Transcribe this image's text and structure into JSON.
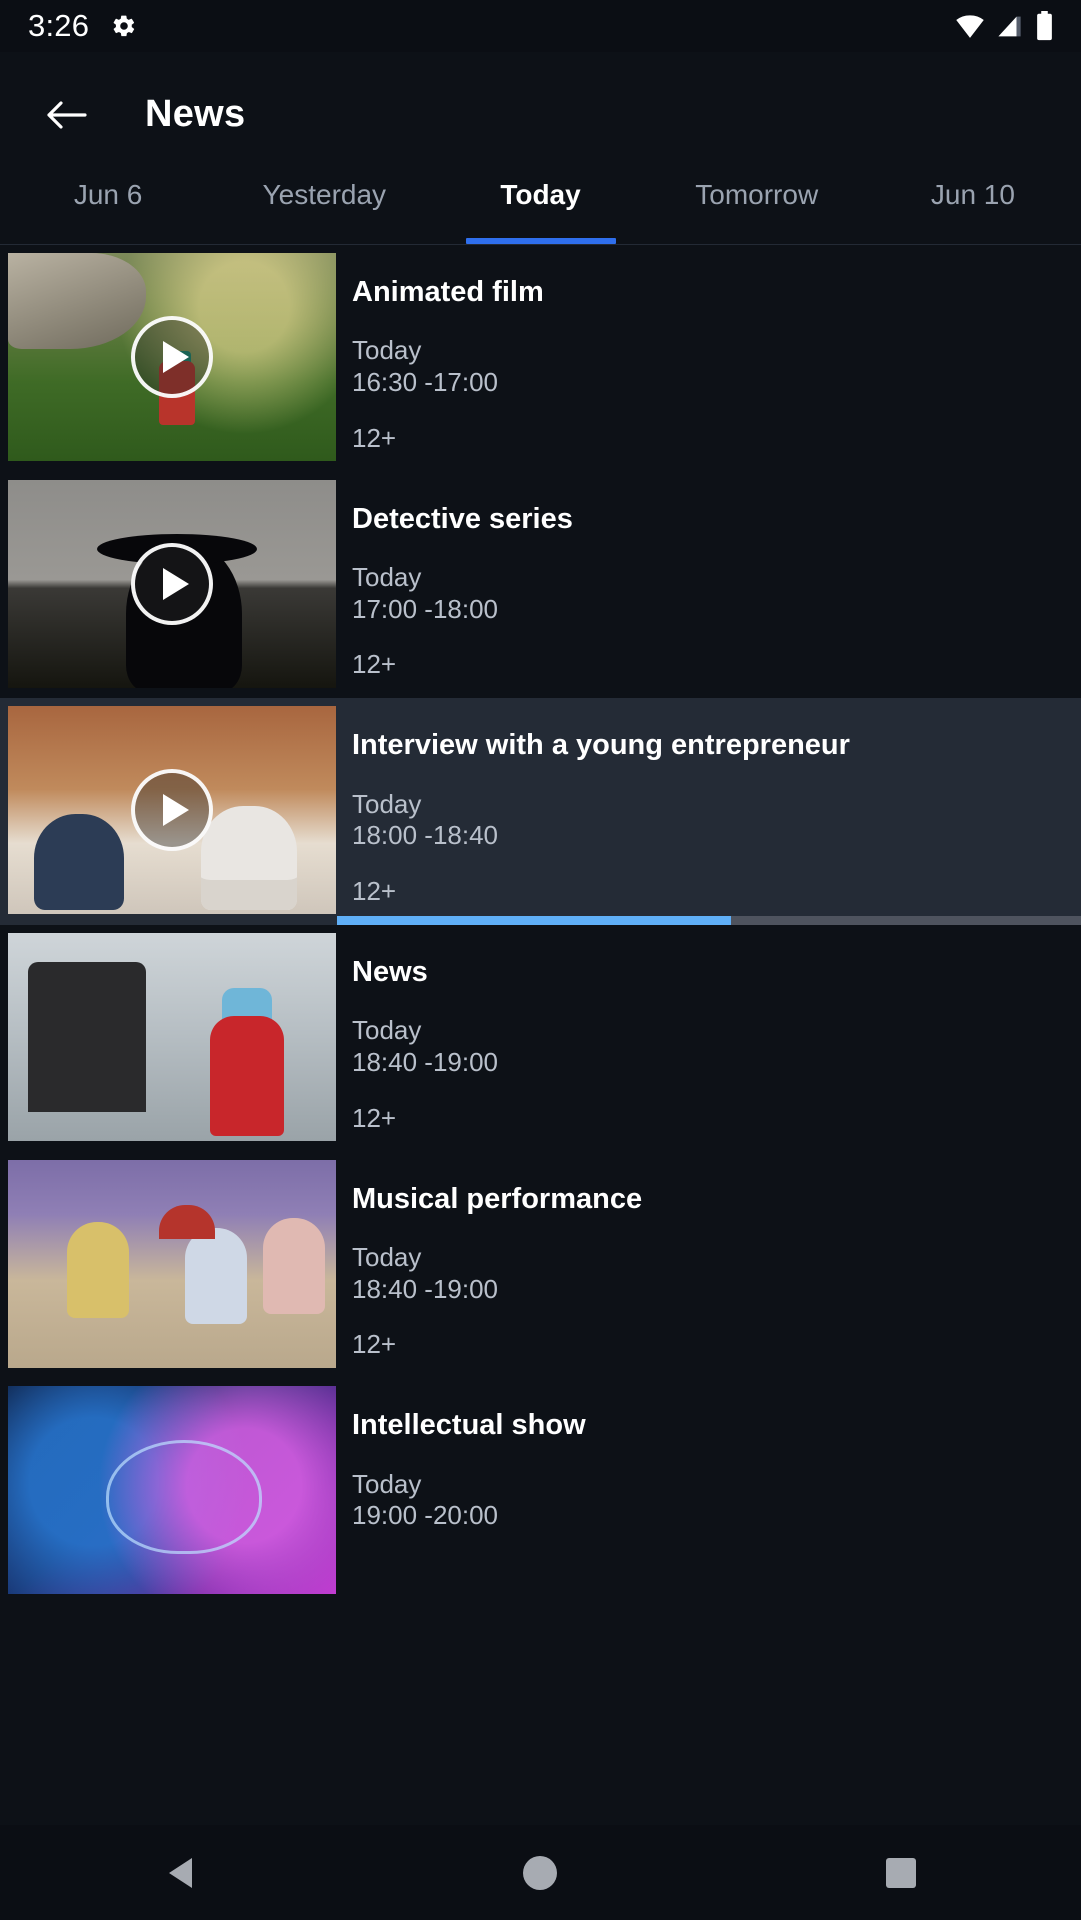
{
  "status_bar": {
    "time": "3:26",
    "icons": [
      "gear-icon",
      "wifi-icon",
      "signal-icon",
      "battery-icon"
    ]
  },
  "app_bar": {
    "back_label": "back-arrow-icon",
    "title": "News"
  },
  "tabs": {
    "items": [
      {
        "label": "Jun 6",
        "active": false
      },
      {
        "label": "Yesterday",
        "active": false
      },
      {
        "label": "Today",
        "active": true
      },
      {
        "label": "Tomorrow",
        "active": false
      },
      {
        "label": "Jun 10",
        "active": false
      }
    ],
    "active_index": 2,
    "indicator_color": "#2f6fed"
  },
  "colors": {
    "background": "#0d1117",
    "status_bar_bg": "#0b0e14",
    "highlight_row_bg": "#242b36",
    "accent_blue": "#2f6fed",
    "progress_fill": "#5faff7",
    "progress_track": "#4e535e",
    "primary_text": "#ffffff",
    "secondary_text": "#b9c0cb",
    "inactive_tab_text": "#9aa3b0"
  },
  "list": {
    "items": [
      {
        "title": "Animated film",
        "day": "Today",
        "time": "16:30 -17:00",
        "age_rating": "12+",
        "has_play": true,
        "highlighted": false,
        "progress_percent": null,
        "art": "art-garden"
      },
      {
        "title": "Detective series",
        "day": "Today",
        "time": "17:00 -18:00",
        "age_rating": "12+",
        "has_play": true,
        "highlighted": false,
        "progress_percent": null,
        "art": "art-detective"
      },
      {
        "title": "Interview with a young entrepreneur",
        "day": "Today",
        "time": "18:00 -18:40",
        "age_rating": "12+",
        "has_play": true,
        "highlighted": true,
        "progress_percent": 53,
        "art": "art-interview"
      },
      {
        "title": "News",
        "day": "Today",
        "time": "18:40 -19:00",
        "age_rating": "12+",
        "has_play": false,
        "highlighted": false,
        "progress_percent": null,
        "art": "art-news"
      },
      {
        "title": "Musical performance",
        "day": "Today",
        "time": "18:40 -19:00",
        "age_rating": "12+",
        "has_play": false,
        "highlighted": false,
        "progress_percent": null,
        "art": "art-musical"
      },
      {
        "title": "Intellectual show",
        "day": "Today",
        "time": "19:00 -20:00",
        "age_rating": "",
        "has_play": false,
        "highlighted": false,
        "progress_percent": null,
        "art": "art-brain"
      }
    ]
  },
  "nav_bar": {
    "buttons": [
      {
        "name": "nav-back-button"
      },
      {
        "name": "nav-home-button"
      },
      {
        "name": "nav-recents-button"
      }
    ]
  }
}
